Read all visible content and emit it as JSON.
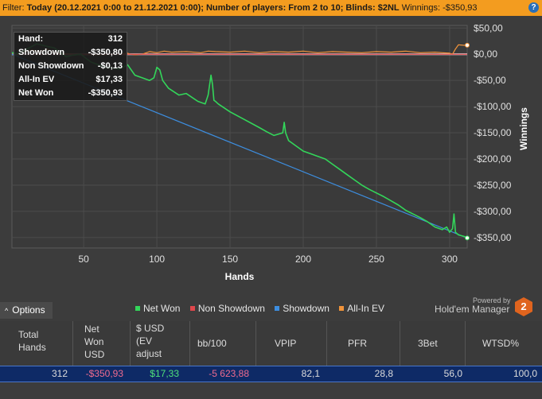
{
  "filter": {
    "label": "Filter:",
    "text": "Today (20.12.2021 0:00 to 21.12.2021 0:00); Number of players: From 2 to 10; Blinds: $2NL",
    "winnings": "Winnings: -$350,93",
    "help_glyph": "?"
  },
  "tooltip": {
    "rows": [
      {
        "key": "Hand:",
        "value": "312"
      },
      {
        "key": "Showdown",
        "value": "-$350,80"
      },
      {
        "key": "Non Showdown",
        "value": "-$0,13"
      },
      {
        "key": "All-In EV",
        "value": "$17,33"
      },
      {
        "key": "Net Won",
        "value": "-$350,93"
      }
    ]
  },
  "chart_data": {
    "type": "line",
    "xlabel": "Hands",
    "ylabel": "Winnings",
    "xlim": [
      1,
      312
    ],
    "ylim": [
      -370,
      55
    ],
    "x_ticks": [
      50,
      100,
      150,
      200,
      250,
      300
    ],
    "y_ticks": [
      {
        "value": 50,
        "label": "$50,00"
      },
      {
        "value": 0,
        "label": "$0,00"
      },
      {
        "value": -50,
        "label": "-$50,00"
      },
      {
        "value": -100,
        "label": "-$100,00"
      },
      {
        "value": -150,
        "label": "-$150,00"
      },
      {
        "value": -200,
        "label": "-$200,00"
      },
      {
        "value": -250,
        "label": "-$250,00"
      },
      {
        "value": -300,
        "label": "-$300,00"
      },
      {
        "value": -350,
        "label": "-$350,00"
      }
    ],
    "grid": true,
    "legend_position": "bottom",
    "series": [
      {
        "name": "Net Won",
        "color": "#33d65a",
        "x": [
          1,
          5,
          10,
          18,
          25,
          30,
          38,
          42,
          48,
          55,
          65,
          75,
          80,
          85,
          90,
          95,
          98,
          100,
          102,
          104,
          108,
          115,
          120,
          128,
          133,
          135,
          137,
          138,
          139,
          140,
          142,
          150,
          160,
          170,
          175,
          180,
          186,
          187,
          188,
          190,
          195,
          200,
          205,
          210,
          215,
          220,
          225,
          230,
          235,
          240,
          245,
          250,
          255,
          260,
          265,
          270,
          275,
          280,
          285,
          290,
          293,
          295,
          298,
          300,
          302,
          303,
          304,
          306,
          310,
          312
        ],
        "y": [
          3,
          1,
          8,
          20,
          15,
          12,
          -5,
          -2,
          0,
          -15,
          -25,
          -28,
          -20,
          -40,
          -45,
          -50,
          -45,
          -25,
          -30,
          -50,
          -65,
          -78,
          -75,
          -90,
          -95,
          -78,
          -40,
          -58,
          -88,
          -90,
          -95,
          -110,
          -125,
          -140,
          -148,
          -155,
          -150,
          -130,
          -150,
          -165,
          -175,
          -185,
          -190,
          -195,
          -200,
          -210,
          -220,
          -230,
          -240,
          -250,
          -258,
          -265,
          -272,
          -280,
          -288,
          -298,
          -305,
          -312,
          -320,
          -330,
          -333,
          -335,
          -330,
          -340,
          -333,
          -305,
          -340,
          -345,
          -348,
          -350.93
        ]
      },
      {
        "name": "Non Showdown",
        "color": "#e0474c",
        "x": [
          1,
          312
        ],
        "y": [
          0,
          -0.13
        ]
      },
      {
        "name": "Showdown",
        "color": "#3d8ee0",
        "x": [
          1,
          312
        ],
        "y": [
          0,
          -350.8
        ]
      },
      {
        "name": "All-In EV",
        "color": "#f0933a",
        "x": [
          1,
          5,
          10,
          15,
          20,
          25,
          30,
          38,
          45,
          60,
          75,
          80,
          82,
          85,
          90,
          95,
          100,
          105,
          110,
          120,
          130,
          135,
          140,
          150,
          160,
          170,
          180,
          190,
          200,
          210,
          220,
          230,
          240,
          250,
          260,
          270,
          280,
          290,
          295,
          300,
          302,
          304,
          306,
          310,
          312
        ],
        "y": [
          0,
          2,
          5,
          8,
          4,
          10,
          3,
          1,
          0,
          -1,
          0,
          2,
          0,
          -1,
          0,
          5,
          3,
          6,
          4,
          5,
          3,
          6,
          5,
          4,
          6,
          3,
          5,
          4,
          6,
          3,
          5,
          4,
          3,
          5,
          4,
          6,
          3,
          4,
          3,
          2,
          0,
          10,
          18,
          17,
          17.33
        ]
      }
    ]
  },
  "legend": [
    {
      "label": "Net Won",
      "color": "#33d65a"
    },
    {
      "label": "Non Showdown",
      "color": "#e0474c"
    },
    {
      "label": "Showdown",
      "color": "#3d8ee0"
    },
    {
      "label": "All-In EV",
      "color": "#f0933a"
    }
  ],
  "options_label": "Options",
  "options_caret": "^",
  "branding": {
    "powered": "Powered by",
    "name": "Hold'em Manager",
    "badge": "2"
  },
  "table": {
    "headers": [
      "Total\nHands",
      "Net\nWon\nUSD",
      "$ USD\n(EV\nadjust",
      "bb/100",
      "VPIP",
      "PFR",
      "3Bet",
      "WTSD%"
    ],
    "row": [
      "312",
      "-$350,93",
      "$17,33",
      "-5 623,88",
      "82,1",
      "28,8",
      "56,0",
      "100,0"
    ],
    "row_colors": [
      "#dcdcdc",
      "#f06b8e",
      "#4fe07a",
      "#f06b8e",
      "#dcdcdc",
      "#dcdcdc",
      "#dcdcdc",
      "#dcdcdc"
    ]
  }
}
